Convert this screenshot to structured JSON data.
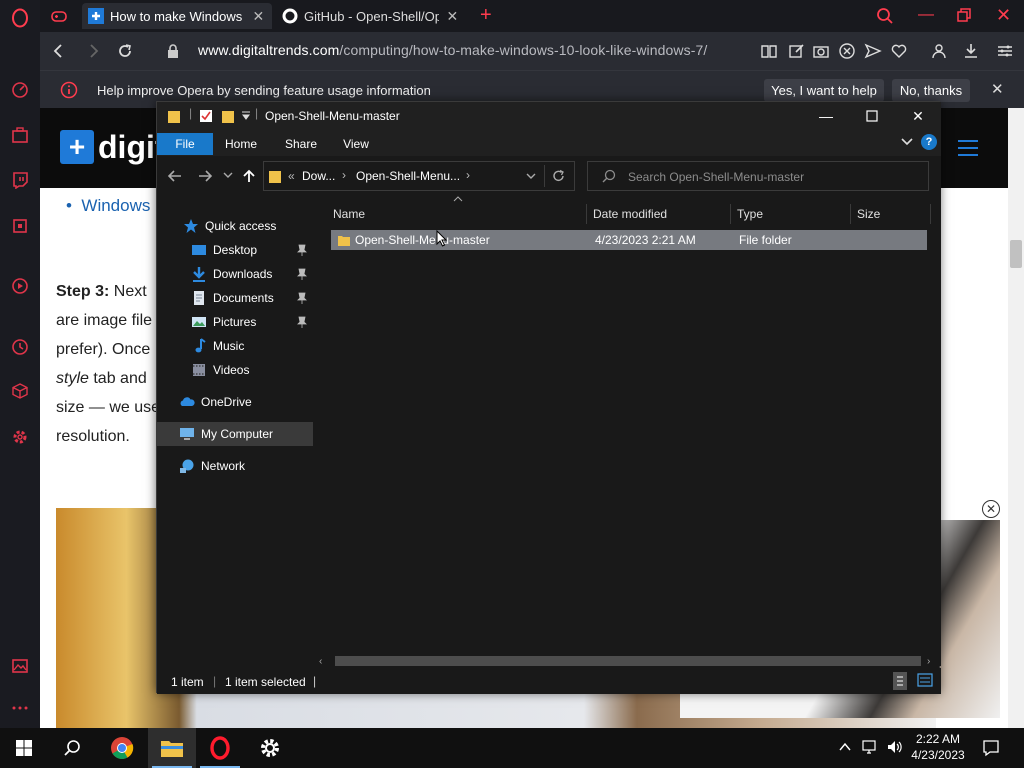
{
  "browser": {
    "tabs": [
      {
        "title": "How to make Windows look",
        "active": true
      },
      {
        "title": "GitHub - Open-Shell/Open",
        "active": false
      }
    ],
    "url_domain": "www.digitaltrends.com",
    "url_path": "/computing/how-to-make-windows-10-look-like-windows-7/",
    "infobar": {
      "text": "Help improve Opera by sending feature usage information",
      "yes_label": "Yes, I want to help",
      "no_label": "No, thanks"
    },
    "accent": "#ff3c4e"
  },
  "webpage": {
    "logo_mark": "+",
    "logo_text": "digit",
    "bullet_link": "Windows",
    "step_label": "Step 3:",
    "lines": [
      " Next",
      "are image file",
      "prefer). Once",
      " tab and",
      "size — we use",
      "resolution."
    ],
    "style_word": "style"
  },
  "explorer": {
    "title": "Open-Shell-Menu-master",
    "ribbon_tabs": [
      "File",
      "Home",
      "Share",
      "View"
    ],
    "breadcrumb": {
      "prefix": "«",
      "parts": [
        "Dow...",
        "Open-Shell-Menu..."
      ]
    },
    "search_placeholder": "Search Open-Shell-Menu-master",
    "nav": {
      "quick_access": "Quick access",
      "items": [
        "Desktop",
        "Downloads",
        "Documents",
        "Pictures",
        "Music",
        "Videos"
      ],
      "onedrive": "OneDrive",
      "my_computer": "My Computer",
      "network": "Network"
    },
    "columns": {
      "name": "Name",
      "date": "Date modified",
      "type": "Type",
      "size": "Size"
    },
    "rows": [
      {
        "name": "Open-Shell-Menu-master",
        "date": "4/23/2023 2:21 AM",
        "type": "File folder",
        "size": ""
      }
    ],
    "status": {
      "count": "1 item",
      "selected": "1 item selected"
    },
    "accent": "#1979ca"
  },
  "taskbar": {
    "time": "2:22 AM",
    "date": "4/23/2023"
  }
}
